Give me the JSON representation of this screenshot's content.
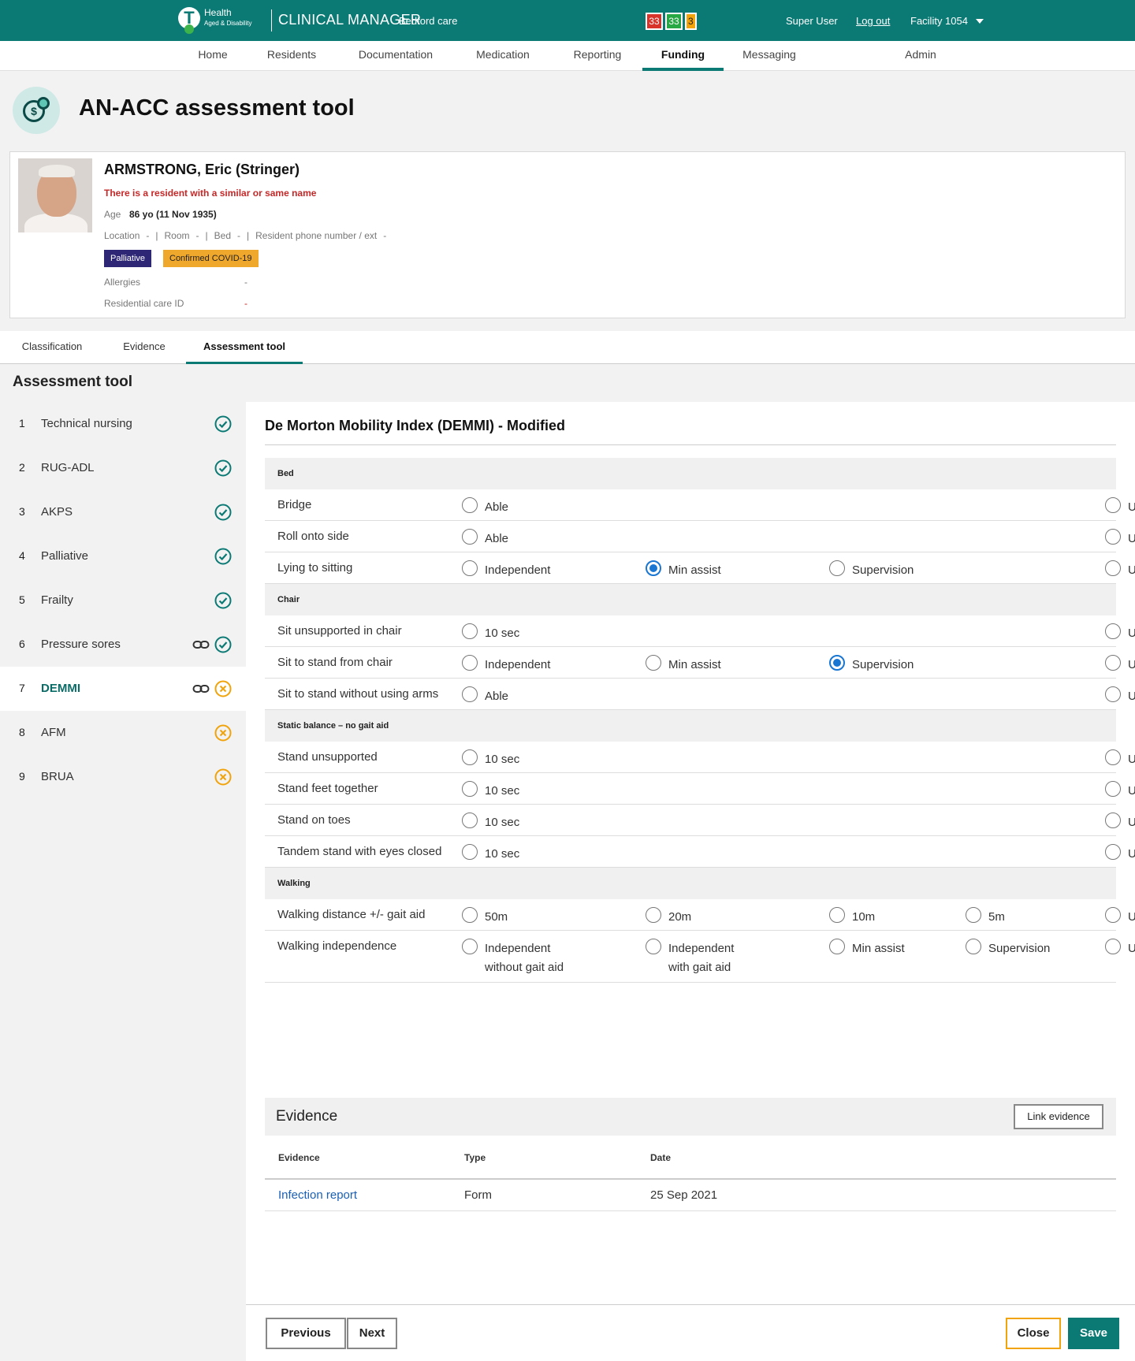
{
  "header": {
    "brand_health": "Health",
    "brand_sub": "Aged & Disability",
    "app_name": "CLINICAL MANAGER",
    "site_name": "Bedford care",
    "counts": [
      "33",
      "33",
      "3"
    ],
    "user": "Super User",
    "logout": "Log out",
    "facility": "Facility 1054",
    "colors": {
      "brand": "#0b7a75",
      "count_red": "#d9342b",
      "count_green": "#28a745",
      "count_amber": "#f0a30a"
    }
  },
  "nav": {
    "items": [
      "Home",
      "Residents",
      "Documentation",
      "Medication",
      "Reporting",
      "Funding",
      "Messaging",
      "Admin"
    ],
    "active": "Funding"
  },
  "page": {
    "title": "AN-ACC assessment tool",
    "icon": "funding-coins-icon"
  },
  "resident": {
    "name": "ARMSTRONG, Eric (Stringer)",
    "warning": "There is a resident with a similar or same name",
    "age_label": "Age",
    "age_value": "86 yo (11 Nov 1935)",
    "location_label": "Location",
    "location_value": "-",
    "room_label": "Room",
    "room_value": "-",
    "bed_label": "Bed",
    "bed_value": "-",
    "phone_label": "Resident phone number / ext",
    "phone_value": "-",
    "separator": "|",
    "tags": [
      "Palliative",
      "Confirmed COVID-19"
    ],
    "allergies_label": "Allergies",
    "allergies_value": "-",
    "rcid_label": "Residential care ID",
    "rcid_value": "-"
  },
  "subtabs": {
    "items": [
      "Classification",
      "Evidence",
      "Assessment tool"
    ],
    "active": "Assessment tool"
  },
  "left": {
    "title": "Assessment tool",
    "steps": [
      {
        "num": "1",
        "label": "Technical nursing",
        "status": "complete",
        "linked": false
      },
      {
        "num": "2",
        "label": "RUG-ADL",
        "status": "complete",
        "linked": false
      },
      {
        "num": "3",
        "label": "AKPS",
        "status": "complete",
        "linked": false
      },
      {
        "num": "4",
        "label": "Palliative",
        "status": "complete",
        "linked": false
      },
      {
        "num": "5",
        "label": "Frailty",
        "status": "complete",
        "linked": false
      },
      {
        "num": "6",
        "label": "Pressure sores",
        "status": "complete",
        "linked": true
      },
      {
        "num": "7",
        "label": "DEMMI",
        "status": "incomplete",
        "linked": true
      },
      {
        "num": "8",
        "label": "AFM",
        "status": "incomplete",
        "linked": false
      },
      {
        "num": "9",
        "label": "BRUA",
        "status": "incomplete",
        "linked": false
      }
    ],
    "active_step": "7"
  },
  "form": {
    "title": "De Morton Mobility Index (DEMMI) - Modified",
    "sections": [
      {
        "label": "Bed",
        "rows": [
          {
            "label": "Bridge",
            "options": [
              "Able",
              "",
              "",
              "",
              "Unable"
            ],
            "selected": null
          },
          {
            "label": "Roll onto side",
            "options": [
              "Able",
              "",
              "",
              "",
              "Unable"
            ],
            "selected": null
          },
          {
            "label": "Lying to sitting",
            "options": [
              "Independent",
              "Min assist",
              "Supervision",
              "",
              "Unable"
            ],
            "selected": "Min assist"
          }
        ]
      },
      {
        "label": "Chair",
        "rows": [
          {
            "label": "Sit unsupported in chair",
            "options": [
              "10 sec",
              "",
              "",
              "",
              "Unable"
            ],
            "selected": null
          },
          {
            "label": "Sit to stand from chair",
            "options": [
              "Independent",
              "Min assist",
              "Supervision",
              "",
              "Unable"
            ],
            "selected": "Supervision"
          },
          {
            "label": "Sit to stand without using arms",
            "options": [
              "Able",
              "",
              "",
              "",
              "Unable"
            ],
            "selected": null
          }
        ]
      },
      {
        "label": "Static balance – no gait aid",
        "rows": [
          {
            "label": "Stand unsupported",
            "options": [
              "10 sec",
              "",
              "",
              "",
              "Unable"
            ],
            "selected": null
          },
          {
            "label": "Stand feet together",
            "options": [
              "10 sec",
              "",
              "",
              "",
              "Unable"
            ],
            "selected": null
          },
          {
            "label": "Stand on toes",
            "options": [
              "10 sec",
              "",
              "",
              "",
              "Unable"
            ],
            "selected": null
          },
          {
            "label": "Tandem stand with eyes closed",
            "options": [
              "10 sec",
              "",
              "",
              "",
              "Unable"
            ],
            "selected": null
          }
        ]
      },
      {
        "label": "Walking",
        "rows": [
          {
            "label": "Walking distance +/- gait aid",
            "options": [
              "50m",
              "20m",
              "10m",
              "5m",
              "Unable"
            ],
            "selected": null
          },
          {
            "label": "Walking independence",
            "options": [
              "Independent without gait aid",
              "Independent with gait aid",
              "Min assist",
              "Supervision",
              "Unable"
            ],
            "selected": null
          }
        ]
      }
    ]
  },
  "evidence": {
    "title": "Evidence",
    "link_button": "Link evidence",
    "columns": [
      "Evidence",
      "Type",
      "Date"
    ],
    "rows": [
      {
        "evidence": "Infection report",
        "type": "Form",
        "date": "25 Sep 2021"
      }
    ]
  },
  "footer": {
    "previous": "Previous",
    "next": "Next",
    "close": "Close",
    "save": "Save"
  }
}
